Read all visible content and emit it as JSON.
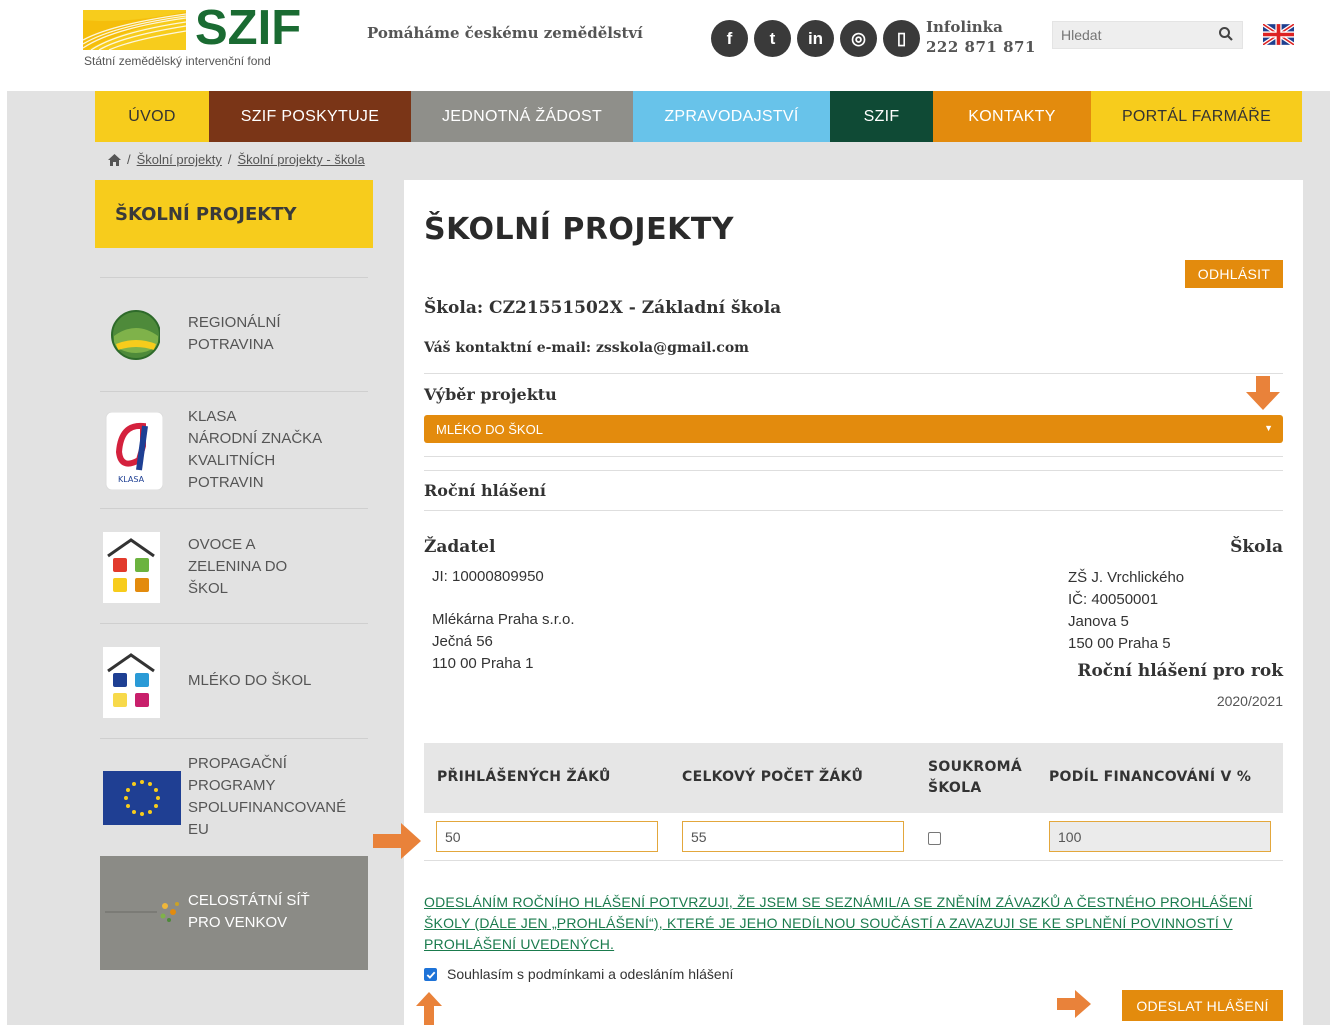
{
  "header": {
    "logo_text": "SZIF",
    "logo_subtitle": "Státní zemědělský intervenční fond",
    "tagline": "Pomáháme českému zemědělství",
    "social_icons": [
      "facebook-icon",
      "twitter-icon",
      "linkedin-icon",
      "instagram-icon",
      "phone-icon"
    ],
    "social_glyphs": [
      "f",
      "t",
      "in",
      "◎",
      "▯"
    ],
    "infolinka_label": "Infolinka",
    "infolinka_number": "222 871 871",
    "search_placeholder": "Hledat",
    "language_flag": "uk-flag-icon"
  },
  "nav": [
    {
      "label": "ÚVOD",
      "bg": "#f7cc1c",
      "color": "#333333"
    },
    {
      "label": "SZIF POSKYTUJE",
      "bg": "#7a3517",
      "color": "#ffffff"
    },
    {
      "label": "JEDNOTNÁ ŽÁDOST",
      "bg": "#8f8f8a",
      "color": "#ffffff"
    },
    {
      "label": "ZPRAVODAJSTVÍ",
      "bg": "#68c3ea",
      "color": "#ffffff"
    },
    {
      "label": "SZIF",
      "bg": "#0f4a35",
      "color": "#ffffff"
    },
    {
      "label": "KONTAKTY",
      "bg": "#e38b0d",
      "color": "#ffffff"
    },
    {
      "label": "PORTÁL FARMÁŘE",
      "bg": "#f7cc1c",
      "color": "#333333"
    }
  ],
  "breadcrumb": {
    "items": [
      "Školní projekty",
      "Školní projekty - škola"
    ]
  },
  "sidebar": {
    "title": "ŠKOLNÍ PROJEKTY",
    "items": [
      {
        "label": "REGIONÁLNÍ POTRAVINA",
        "icon": "regionalni-potravina-icon"
      },
      {
        "label": "KLASA NÁRODNÍ ZNAČKA KVALITNÍCH POTRAVIN",
        "icon": "klasa-icon"
      },
      {
        "label": "OVOCE A ZELENINA DO ŠKOL",
        "icon": "ovoce-zelenina-icon"
      },
      {
        "label": "MLÉKO DO ŠKOL",
        "icon": "mleko-icon"
      },
      {
        "label": "PROPAGAČNÍ PROGRAMY SPOLUFINANCOVANÉ EU",
        "icon": "eu-flag-icon"
      },
      {
        "label": "CELOSTÁTNÍ SÍŤ PRO VENKOV",
        "icon": "celostatni-sit-icon"
      }
    ]
  },
  "main": {
    "title": "ŠKOLNÍ PROJEKTY",
    "logout_label": "ODHLÁSIT",
    "school_line": "Škola: CZ21551502X - Základní škola",
    "email_line": "Váš kontaktní e-mail: zsskola@gmail.com",
    "project_heading": "Výběr projektu",
    "project_selected": "MLÉKO DO ŠKOL",
    "annual_heading": "Roční hlášení",
    "applicant": {
      "heading": "Žadatel",
      "ji": "JI: 10000809950",
      "name": "Mlékárna Praha s.r.o.",
      "street": "Ječná 56",
      "city": "110 00 Praha 1"
    },
    "school": {
      "heading": "Škola",
      "name": "ZŠ J. Vrchlického",
      "ico": "IČ: 40050001",
      "street": "Janova 5",
      "city": "150 00 Praha 5",
      "report_year_label": "Roční hlášení pro rok",
      "report_year": "2020/2021"
    },
    "table": {
      "headers": [
        "PŘIHLÁŠENÝCH ŽÁKŮ",
        "CELKOVÝ POČET ŽÁKŮ",
        "SOUKROMÁ ŠKOLA",
        "PODÍL FINANCOVÁNÍ V %"
      ],
      "registered_pupils": "50",
      "total_pupils": "55",
      "private_school": false,
      "financing_share": "100"
    },
    "consent_text": "ODESLÁNÍM ROČNÍHO HLÁŠENÍ POTVRZUJI, ŽE JSEM SE SEZNÁMIL/A SE ZNĚNÍM ZÁVAZKŮ A ČESTNÉHO PROHLÁŠENÍ ŠKOLY (DÁLE JEN „PROHLÁŠENÍ“), KTERÉ JE JEHO NEDÍLNOU SOUČÁSTÍ A ZAVAZUJI SE KE SPLNĚNÍ POVINNOSTÍ V PROHLÁŠENÍ UVEDENÝCH.",
    "agree_label": "Souhlasím s podmínkami a odesláním hlášení",
    "agree_checked": true,
    "submit_label": "ODESLAT HLÁŠENÍ"
  },
  "colors": {
    "accent_orange": "#e38b0d",
    "brand_green": "#1a6b32",
    "sidebar_yellow": "#f7cc1c",
    "link_green": "#1a7b4d"
  }
}
